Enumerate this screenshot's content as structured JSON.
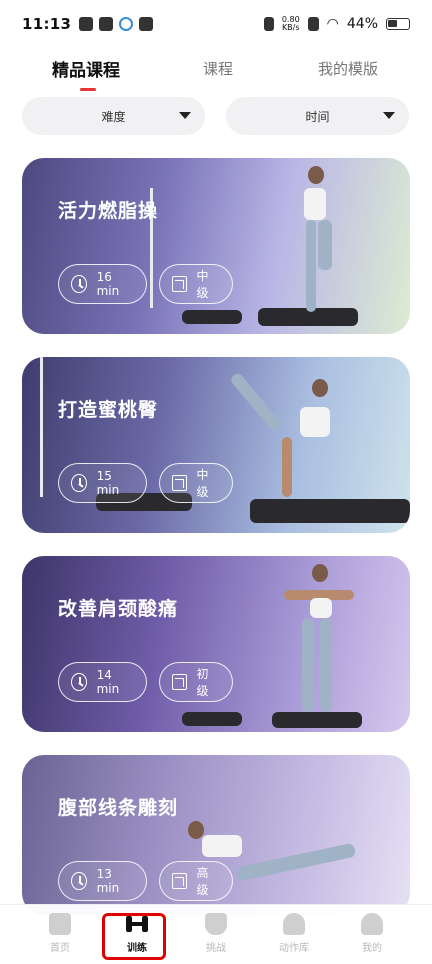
{
  "status_bar": {
    "time": "11:13",
    "speed_value": "0.80",
    "speed_unit": "KB/s",
    "battery": "44%"
  },
  "tabs": [
    {
      "label": "精品课程",
      "active": true
    },
    {
      "label": "课程",
      "active": false
    },
    {
      "label": "我的模版",
      "active": false
    }
  ],
  "filters": [
    {
      "label": "难度",
      "icon": "caret-down-icon"
    },
    {
      "label": "时间",
      "icon": "caret-down-icon"
    }
  ],
  "cards": [
    {
      "title": "活力燃脂操",
      "duration": "16 min",
      "level": "中级"
    },
    {
      "title": "打造蜜桃臀",
      "duration": "15 min",
      "level": "中级"
    },
    {
      "title": "改善肩颈酸痛",
      "duration": "14 min",
      "level": "初级"
    },
    {
      "title": "腹部线条雕刻",
      "duration": "13 min",
      "level": "高级"
    }
  ],
  "bottom_nav": [
    {
      "label": "首页",
      "icon": "home-icon",
      "active": false
    },
    {
      "label": "训练",
      "icon": "dumbbell-icon",
      "active": true
    },
    {
      "label": "挑战",
      "icon": "trophy-icon",
      "active": false
    },
    {
      "label": "动作库",
      "icon": "exercise-icon",
      "active": false
    },
    {
      "label": "我的",
      "icon": "profile-icon",
      "active": false
    }
  ],
  "colors": {
    "accent": "#e53935",
    "highlight": "#e00000"
  }
}
